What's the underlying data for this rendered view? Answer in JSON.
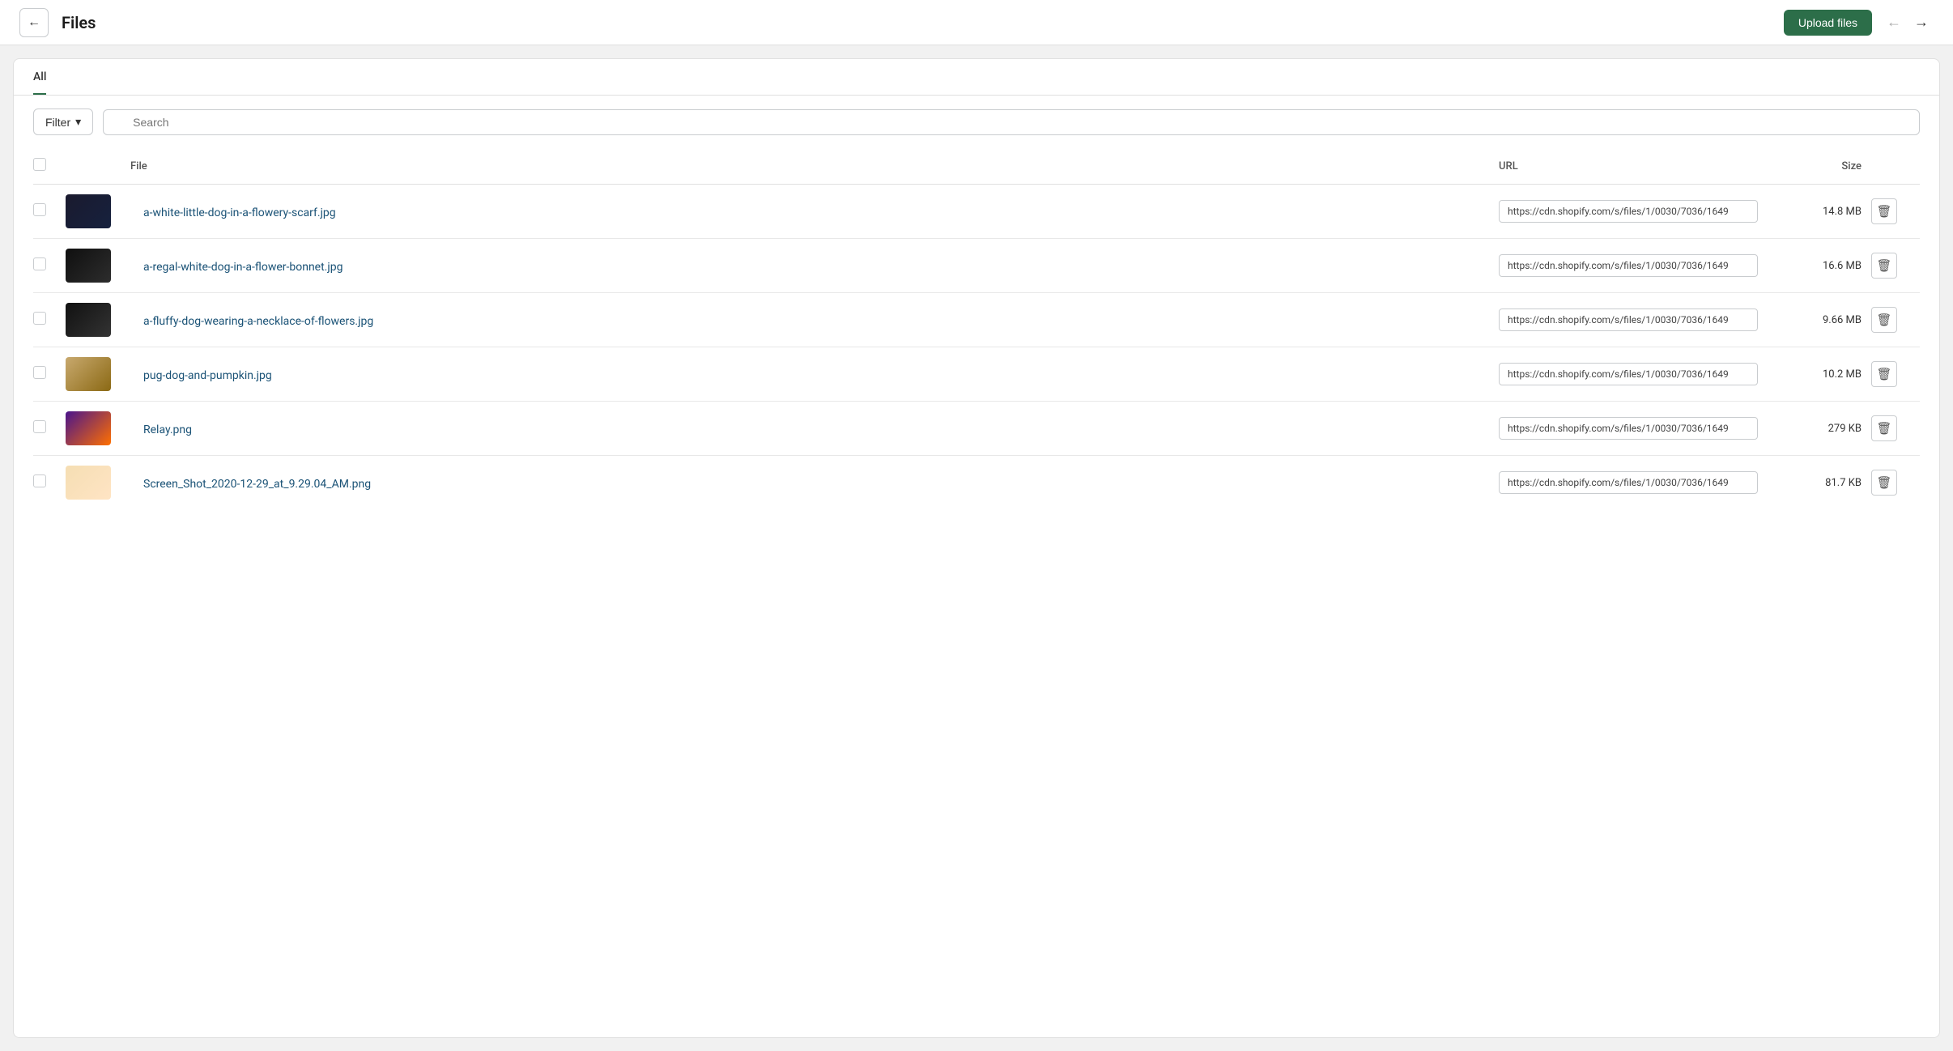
{
  "header": {
    "title": "Files",
    "upload_button": "Upload files",
    "back_arrow": "←",
    "forward_arrow": "→"
  },
  "tabs": [
    {
      "label": "All",
      "active": true
    }
  ],
  "toolbar": {
    "filter_label": "Filter",
    "search_placeholder": "Search"
  },
  "table": {
    "columns": [
      "",
      "",
      "File",
      "URL",
      "Size",
      ""
    ],
    "rows": [
      {
        "file_name": "a-white-little-dog-in-a-flowery-scarf.jpg",
        "url": "https://cdn.shopify.com/s/files/1/0030/7036/1649",
        "size": "14.8 MB",
        "thumb_class": "thumb-dog1"
      },
      {
        "file_name": "a-regal-white-dog-in-a-flower-bonnet.jpg",
        "url": "https://cdn.shopify.com/s/files/1/0030/7036/1649",
        "size": "16.6 MB",
        "thumb_class": "thumb-dog2"
      },
      {
        "file_name": "a-fluffy-dog-wearing-a-necklace-of-flowers.jpg",
        "url": "https://cdn.shopify.com/s/files/1/0030/7036/1649",
        "size": "9.66 MB",
        "thumb_class": "thumb-dog3"
      },
      {
        "file_name": "pug-dog-and-pumpkin.jpg",
        "url": "https://cdn.shopify.com/s/files/1/0030/7036/1649",
        "size": "10.2 MB",
        "thumb_class": "thumb-dog4"
      },
      {
        "file_name": "Relay.png",
        "url": "https://cdn.shopify.com/s/files/1/0030/7036/1649",
        "size": "279 KB",
        "thumb_class": "thumb-relay"
      },
      {
        "file_name": "Screen_Shot_2020-12-29_at_9.29.04_AM.png",
        "url": "https://cdn.shopify.com/s/files/1/0030/7036/1649",
        "size": "81.7 KB",
        "thumb_class": "thumb-screenshot"
      }
    ]
  }
}
